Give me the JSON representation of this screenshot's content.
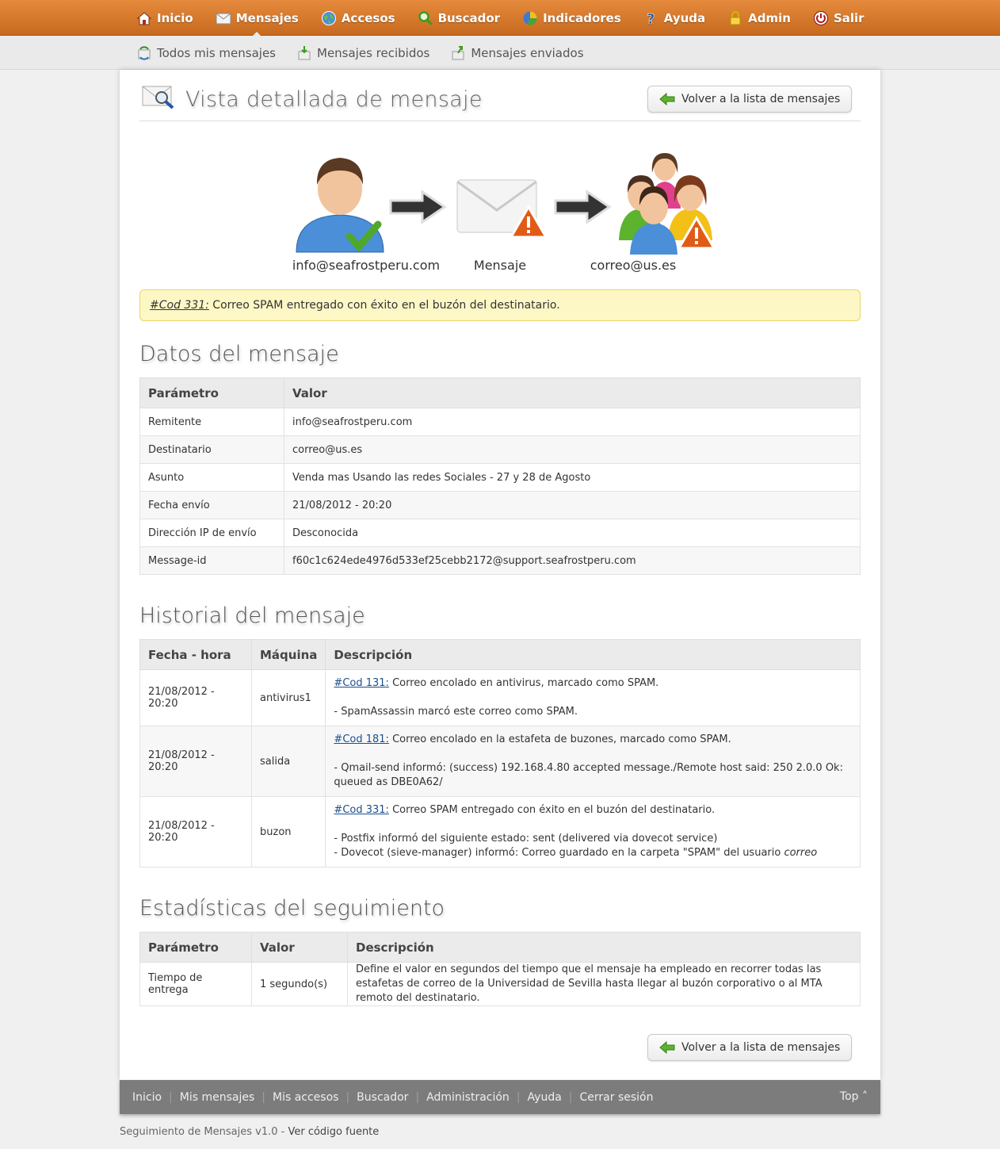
{
  "topnav": {
    "items": [
      {
        "label": "Inicio",
        "icon": "home-icon"
      },
      {
        "label": "Mensajes",
        "icon": "envelope-icon",
        "active": true
      },
      {
        "label": "Accesos",
        "icon": "globe-icon"
      },
      {
        "label": "Buscador",
        "icon": "search-icon"
      },
      {
        "label": "Indicadores",
        "icon": "pie-chart-icon"
      },
      {
        "label": "Ayuda",
        "icon": "help-icon"
      },
      {
        "label": "Admin",
        "icon": "lock-icon"
      },
      {
        "label": "Salir",
        "icon": "power-icon"
      }
    ]
  },
  "subnav": {
    "items": [
      {
        "label": "Todos mis mensajes",
        "icon": "refresh-icon"
      },
      {
        "label": "Mensajes recibidos",
        "icon": "inbox-icon"
      },
      {
        "label": "Mensajes enviados",
        "icon": "outbox-icon"
      }
    ]
  },
  "page": {
    "title": "Vista detallada de mensaje",
    "back_button": "Volver a la lista de mensajes"
  },
  "flow": {
    "sender": "info@seafrostperu.com",
    "message": "Mensaje",
    "recipient": "correo@us.es"
  },
  "alert": {
    "code": "#Cod 331:",
    "text": " Correo SPAM entregado con éxito en el buzón del destinatario."
  },
  "datos": {
    "title": "Datos del mensaje",
    "headers": [
      "Parámetro",
      "Valor"
    ],
    "rows": [
      [
        "Remitente",
        "info@seafrostperu.com"
      ],
      [
        "Destinatario",
        "correo@us.es"
      ],
      [
        "Asunto",
        "Venda mas Usando las redes Sociales - 27 y 28 de Agosto"
      ],
      [
        "Fecha envío",
        "21/08/2012 - 20:20"
      ],
      [
        "Dirección IP de envío",
        "Desconocida"
      ],
      [
        "Message-id",
        "f60c1c624ede4976d533ef25cebb2172@support.seafrostperu.com"
      ]
    ]
  },
  "historial": {
    "title": "Historial del mensaje",
    "headers": [
      "Fecha - hora",
      "Máquina",
      "Descripción"
    ],
    "rows": [
      {
        "fecha": "21/08/2012 - 20:20",
        "maquina": "antivirus1",
        "code": "#Cod 131:",
        "summary": " Correo encolado en antivirus, marcado como SPAM.",
        "details": [
          "- SpamAssassin marcó este correo como SPAM."
        ]
      },
      {
        "fecha": "21/08/2012 - 20:20",
        "maquina": "salida",
        "code": "#Cod 181:",
        "summary": " Correo encolado en la estafeta de buzones, marcado como SPAM.",
        "details": [
          "- Qmail-send informó: (success) 192.168.4.80 accepted message./Remote host said: 250 2.0.0 Ok: queued as DBE0A62/"
        ]
      },
      {
        "fecha": "21/08/2012 - 20:20",
        "maquina": "buzon",
        "code": "#Cod 331:",
        "summary": " Correo SPAM entregado con éxito en el buzón del destinatario.",
        "details": [
          "- Postfix informó del siguiente estado: sent (delivered via dovecot service)",
          "- Dovecot (sieve-manager) informó: Correo guardado en la carpeta \"SPAM\" del usuario "
        ],
        "user": "correo"
      }
    ]
  },
  "estadisticas": {
    "title": "Estadísticas del seguimiento",
    "headers": [
      "Parámetro",
      "Valor",
      "Descripción"
    ],
    "rows": [
      [
        "Tiempo de entrega",
        "1 segundo(s)",
        "Define el valor en segundos del tiempo que el mensaje ha empleado en recorrer todas las estafetas de correo de la Universidad de Sevilla hasta llegar al buzón corporativo o al MTA remoto del destinatario."
      ]
    ]
  },
  "footer": {
    "links": [
      "Inicio",
      "Mis mensajes",
      "Mis accesos",
      "Buscador",
      "Administración",
      "Ayuda",
      "Cerrar sesión"
    ],
    "top": "Top ˄",
    "credits_text": "Seguimiento de Mensajes v1.0 - ",
    "credits_link": "Ver código fuente"
  },
  "colors": {
    "topbar": "#d9772a",
    "alert_bg": "#fdf7c6",
    "footer_bg": "#7c7c7c"
  }
}
